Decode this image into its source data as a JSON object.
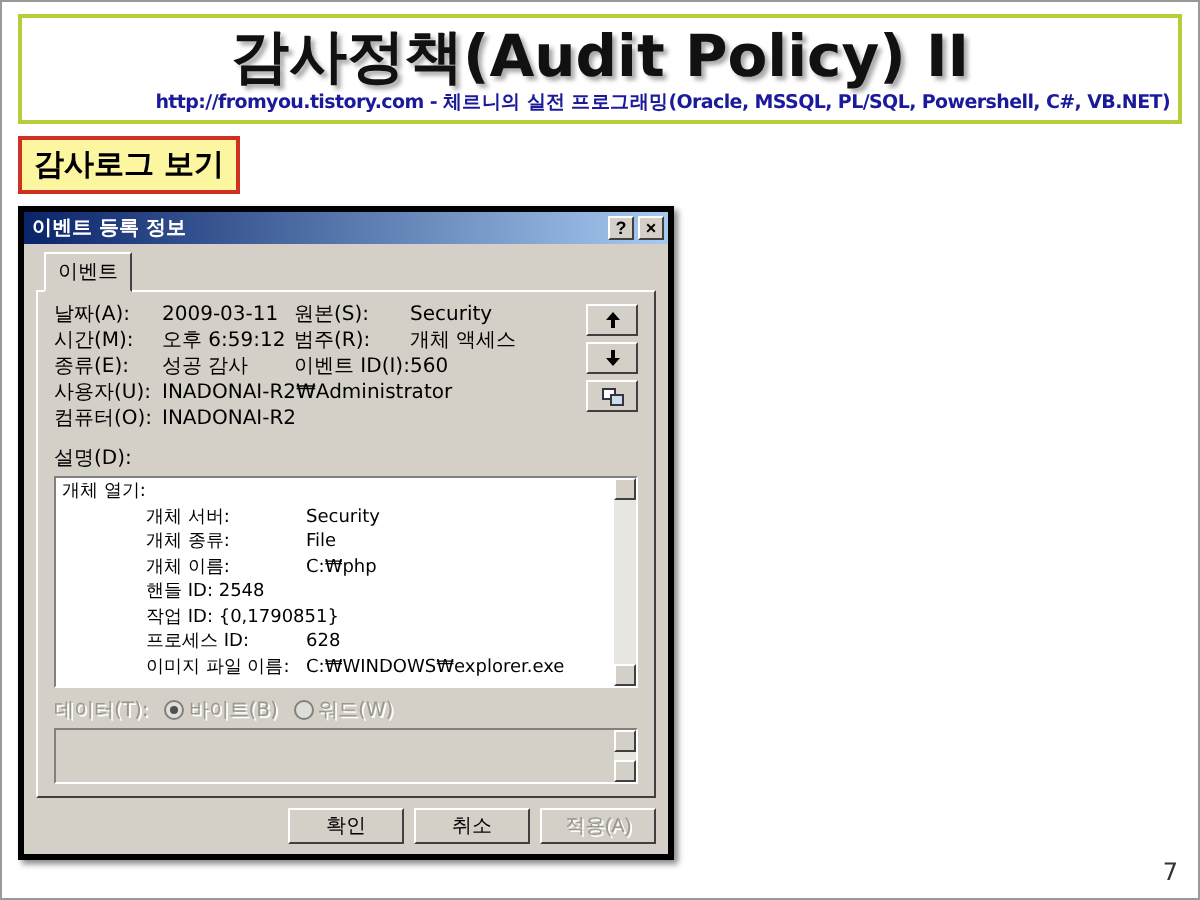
{
  "slide": {
    "title": "감사정책(Audit Policy) II",
    "subtitle": "http://fromyou.tistory.com - 체르니의 실전 프로그래밍(Oracle, MSSQL, PL/SQL, Powershell, C#, VB.NET)",
    "section_label": "감사로그 보기",
    "page_number": "7"
  },
  "dialog": {
    "title": "이벤트 등록 정보",
    "help_button": "?",
    "close_button": "×",
    "tabs": [
      {
        "label": "이벤트",
        "selected": true
      }
    ],
    "fields": [
      {
        "label": "날짜(A):",
        "value": "2009-03-11",
        "label2": "원본(S):",
        "value2": "Security"
      },
      {
        "label": "시간(M):",
        "value": "오후 6:59:12",
        "label2": "범주(R):",
        "value2": "개체 액세스"
      },
      {
        "label": "종류(E):",
        "value": "성공 감사",
        "label2": "이벤트 ID(I):",
        "value2": "560"
      },
      {
        "label": "사용자(U):",
        "value": "INADONAI-R2₩Administrator"
      },
      {
        "label": "컴퓨터(O):",
        "value": "INADONAI-R2"
      }
    ],
    "nav_buttons": [
      {
        "kind": "up"
      },
      {
        "kind": "down"
      },
      {
        "kind": "copy"
      }
    ],
    "description_label": "설명(D):",
    "description_lines": [
      {
        "label": "개체 열기:",
        "indent": false
      },
      {
        "label": "개체 서버:",
        "value": "Security",
        "indent": true
      },
      {
        "label": "개체 종류:",
        "value": "File",
        "indent": true
      },
      {
        "label": "개체 이름:",
        "value": "C:₩php",
        "indent": true
      },
      {
        "label": "핸들 ID: 2548",
        "indent": true
      },
      {
        "label": "작업 ID: {0,1790851}",
        "indent": true
      },
      {
        "label": "프로세스 ID:",
        "value": "628",
        "indent": true
      },
      {
        "label": "이미지 파일 이름:",
        "value": "C:₩WINDOWS₩explorer.exe",
        "indent": true
      }
    ],
    "data_label": "데이터(T):",
    "data_disabled": true,
    "radios": [
      {
        "label": "바이트(B)",
        "selected": true
      },
      {
        "label": "워드(W)",
        "selected": false
      }
    ],
    "buttons": [
      {
        "label": "확인",
        "disabled": false
      },
      {
        "label": "취소",
        "disabled": false
      },
      {
        "label": "적용(A)",
        "disabled": true
      }
    ]
  }
}
